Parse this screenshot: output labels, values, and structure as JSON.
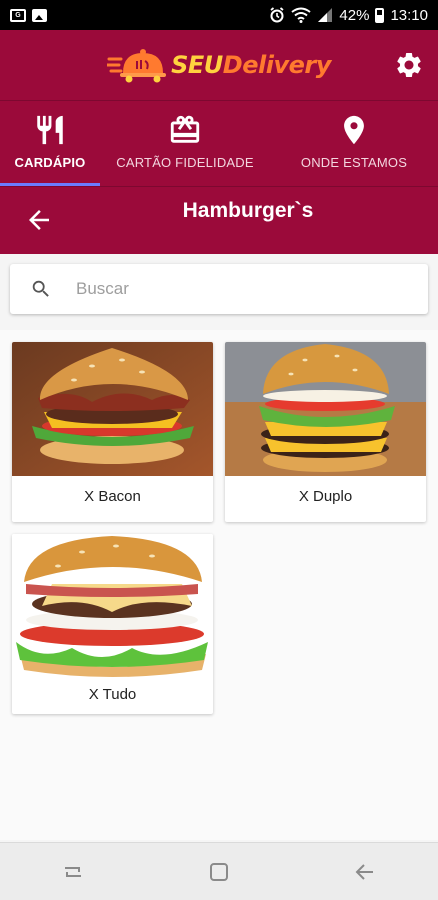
{
  "status_bar": {
    "battery": "42%",
    "time": "13:10",
    "icons": [
      "notification-box-icon",
      "image-icon",
      "alarm-icon",
      "wifi-icon",
      "signal-icon",
      "battery-icon"
    ]
  },
  "header": {
    "logo_seu": "SEU",
    "logo_delivery": "Delivery",
    "brand_color": "#9b0a3a",
    "accent_yellow": "#ffd23f",
    "accent_orange": "#ff7a2f"
  },
  "tabs": [
    {
      "label": "CARDÁPIO",
      "icon": "fork-knife-icon",
      "active": true
    },
    {
      "label": "CARTÃO FIDELIDADE",
      "icon": "gift-icon",
      "active": false
    },
    {
      "label": "ONDE ESTAMOS",
      "icon": "location-pin-icon",
      "active": false
    }
  ],
  "sub_header": {
    "title": "Hamburger`s"
  },
  "search": {
    "placeholder": "Buscar",
    "value": ""
  },
  "products": [
    {
      "name": "X Bacon"
    },
    {
      "name": "X Duplo"
    },
    {
      "name": "X Tudo"
    }
  ]
}
